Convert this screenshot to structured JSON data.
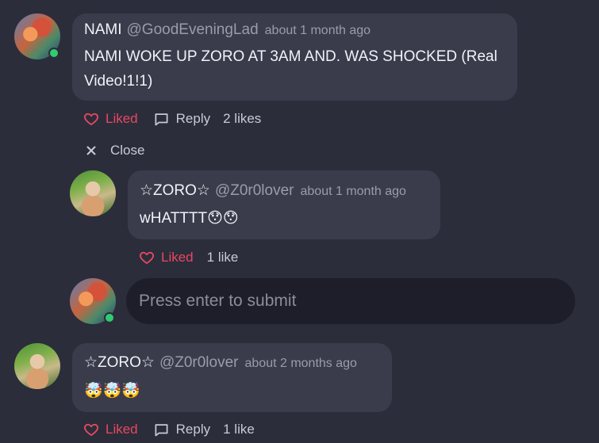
{
  "comments": [
    {
      "name": "NAMI",
      "handle": "@GoodEveningLad",
      "time": "about 1 month ago",
      "text": "NAMI WOKE UP ZORO AT 3AM AND. WAS SHOCKED (Real Video!1!1)",
      "liked_label": "Liked",
      "reply_label": "Reply",
      "likes": "2 likes",
      "avatar_icon": "nami-avatar"
    },
    {
      "name": "☆ZORO☆",
      "handle": "@Z0r0lover",
      "time": "about 1 month ago",
      "text": "wHATTTT😯😯",
      "liked_label": "Liked",
      "likes": "1 like",
      "avatar_icon": "zoro-avatar"
    },
    {
      "name": "☆ZORO☆",
      "handle": "@Z0r0lover",
      "time": "about 2 months ago",
      "text": "🤯🤯🤯",
      "liked_label": "Liked",
      "reply_label": "Reply",
      "likes": "1 like",
      "avatar_icon": "zoro-avatar"
    }
  ],
  "close_label": "Close",
  "reply_input": {
    "placeholder": "Press enter to submit"
  },
  "colors": {
    "background": "#2b2d3b",
    "bubble": "#3a3c4c",
    "liked": "#e8485f",
    "online": "#2ecc71"
  }
}
